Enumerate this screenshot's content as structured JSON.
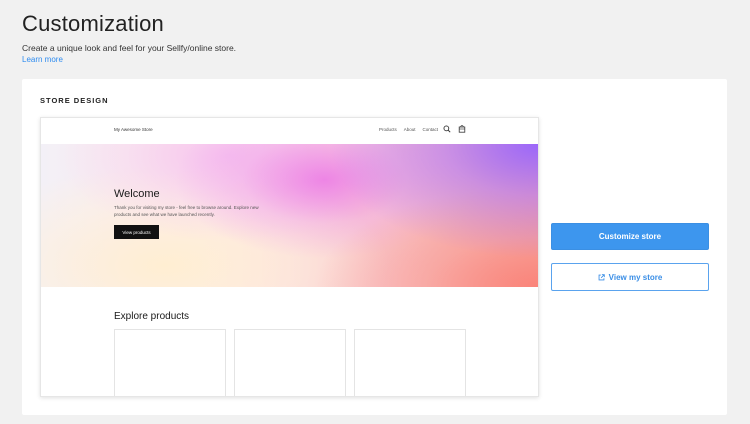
{
  "page": {
    "title": "Customization",
    "subtitle": "Create a unique look and feel for your Sellfy/online store.",
    "learn_more": "Learn more"
  },
  "store_design": {
    "heading": "STORE DESIGN",
    "customize_button": "Customize store",
    "view_button": "View my store",
    "view_button_icon": "external-link-icon",
    "accent_color": "#3d96ee"
  },
  "preview": {
    "store_name": "My Awesome Store",
    "nav_links": [
      "Products",
      "About",
      "Contact"
    ],
    "nav_icons": [
      "search-icon",
      "cart-icon"
    ],
    "hero": {
      "title": "Welcome",
      "text": "Thank you for visiting my store - feel free to browse around. Explore new products and see what we have launched recently.",
      "button": "View products"
    },
    "explore_title": "Explore products"
  }
}
